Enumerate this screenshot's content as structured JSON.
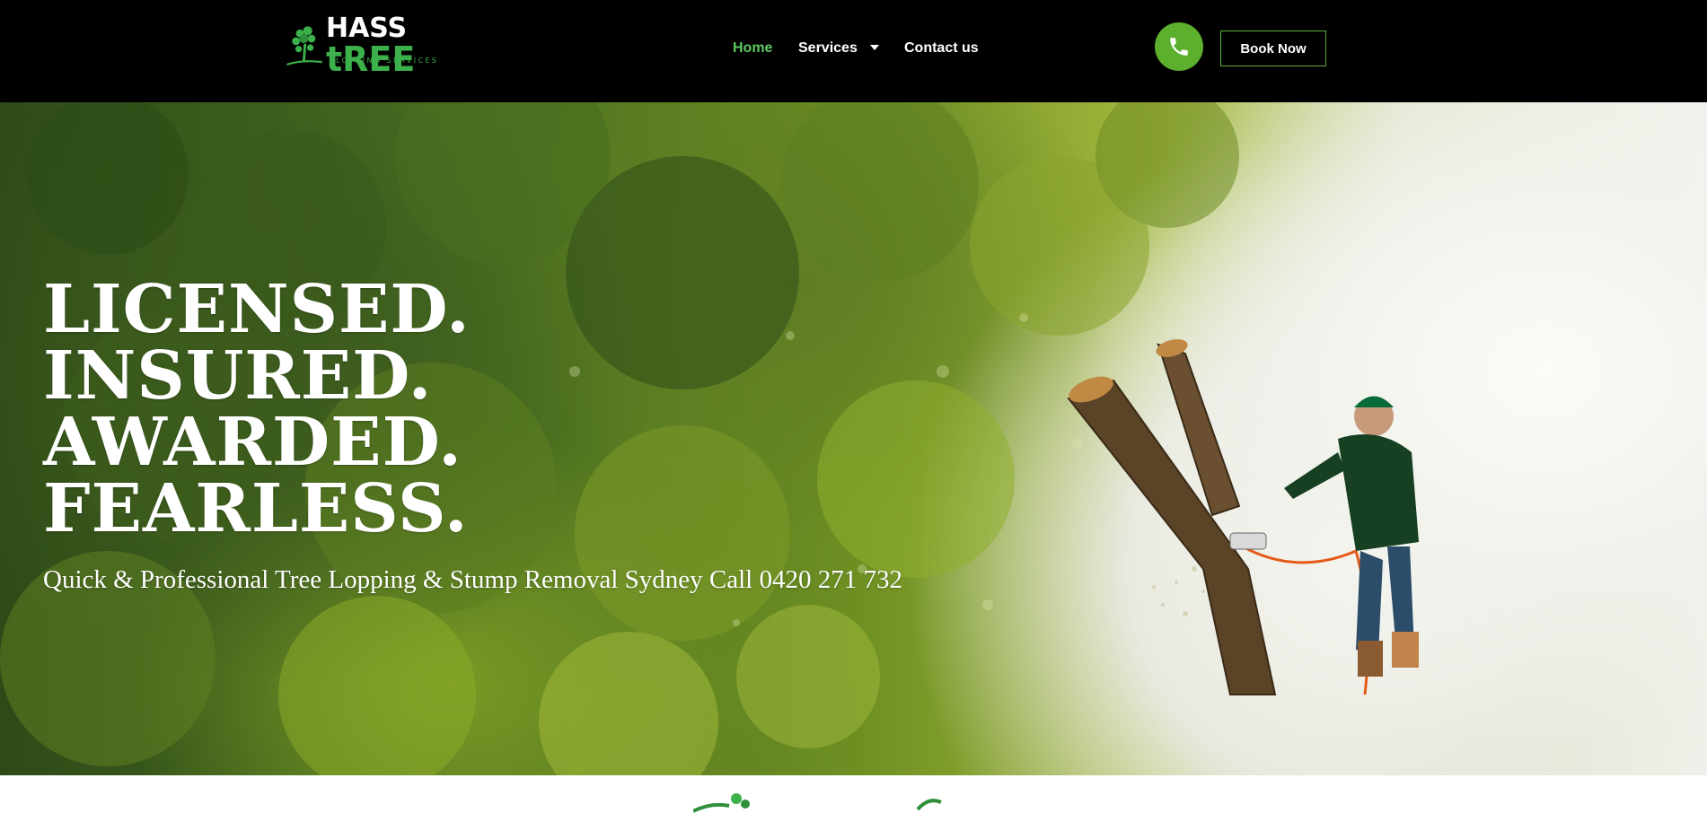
{
  "header": {
    "logo": {
      "name_part1": "HASS ",
      "name_part2": "tREE",
      "tagline": "LOPPING SERVICES",
      "icon": "tree-icon"
    },
    "nav": [
      {
        "label": "Home",
        "active": true
      },
      {
        "label": "Services",
        "has_dropdown": true
      },
      {
        "label": "Contact us"
      }
    ],
    "phone_icon": "phone-icon",
    "book_button": "Book Now"
  },
  "hero": {
    "headline": [
      "LICENSED.",
      "INSURED.",
      "AWARDED.",
      "FEARLESS."
    ],
    "subheading": "Quick & Professional Tree Lopping & Stump Removal Sydney Call 0420 271 732"
  },
  "colors": {
    "header_bg": "#000000",
    "brand_green": "#5cb02e",
    "nav_active": "#5ec75f",
    "text_white": "#ffffff"
  }
}
